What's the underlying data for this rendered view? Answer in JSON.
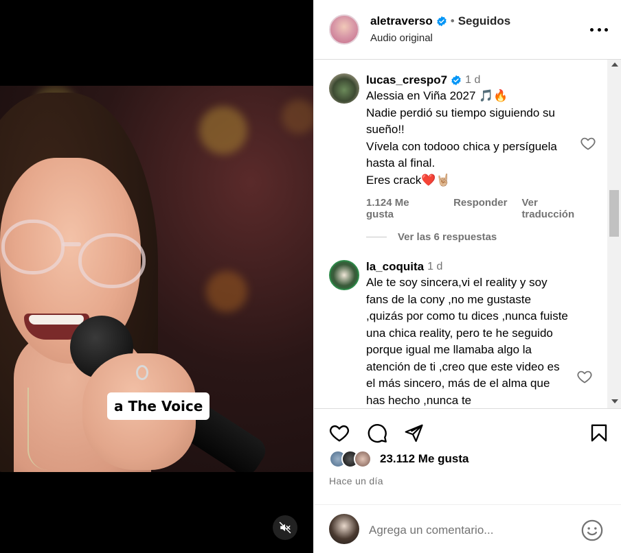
{
  "video": {
    "caption": "a The Voice",
    "mute_state": "muted"
  },
  "header": {
    "username": "aletraverso",
    "separator": "•",
    "follow_state": "Seguidos",
    "audio": "Audio original"
  },
  "comments": [
    {
      "username": "lucas_crespo7",
      "verified": true,
      "time": "1 d",
      "text": "Alessia en Viña 2027 🎵🔥\nNadie perdió su tiempo siguiendo su sueño!!\nVívela con todooo chica y persíguela hasta al final.\nEres crack❤️🤘🏼",
      "likes": "1.124 Me gusta",
      "reply_label": "Responder",
      "translate_label": "Ver traducción",
      "view_replies": "Ver las 6 respuestas"
    },
    {
      "username": "la_coquita",
      "verified": false,
      "time": "1 d",
      "text": "Ale te soy sincera,vi el reality y soy fans de la cony ,no me gustaste ,quizás por como tu dices ,nunca fuiste una chica reality, pero te he seguido porque igual me llamaba algo la atención de ti ,creo que este video es el más sincero, más de el alma que has hecho ,nunca te"
    }
  ],
  "post": {
    "likes_count": "23.112 Me gusta",
    "time_ago": "Hace un día",
    "comment_placeholder": "Agrega un comentario..."
  },
  "icons": {
    "verified": "verified-badge-icon",
    "more": "more-options-icon",
    "like": "heart-icon",
    "comment": "comment-icon",
    "share": "paper-plane-icon",
    "save": "bookmark-icon",
    "emoji": "emoji-icon",
    "mute": "speaker-muted-icon"
  },
  "colors": {
    "verified_blue": "#0095f6",
    "secondary_text": "#737373",
    "caption_bg": "#ffffff"
  }
}
